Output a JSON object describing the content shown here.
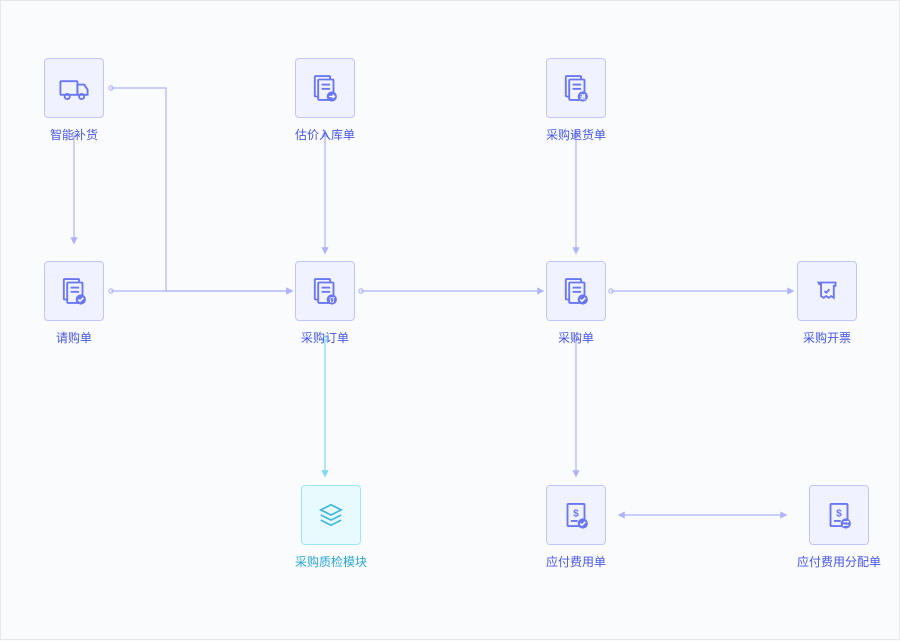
{
  "nodes": {
    "smart_replenish": {
      "label": "智能补货",
      "icon": "truck"
    },
    "purchase_request": {
      "label": "请购单",
      "icon": "doc-check"
    },
    "estimate_inbound": {
      "label": "估价入库单",
      "icon": "doc-arrow"
    },
    "purchase_order": {
      "label": "采购订单",
      "icon": "doc-badge"
    },
    "quality_check": {
      "label": "采购质检模块",
      "icon": "layers"
    },
    "purchase_return": {
      "label": "采购退货单",
      "icon": "doc-return"
    },
    "purchase_bill": {
      "label": "采购单",
      "icon": "doc-check"
    },
    "payable_expense": {
      "label": "应付费用单",
      "icon": "doc-money-check"
    },
    "purchase_invoice": {
      "label": "采购开票",
      "icon": "receipt"
    },
    "payable_allocation": {
      "label": "应付费用分配单",
      "icon": "doc-money-swap"
    }
  }
}
